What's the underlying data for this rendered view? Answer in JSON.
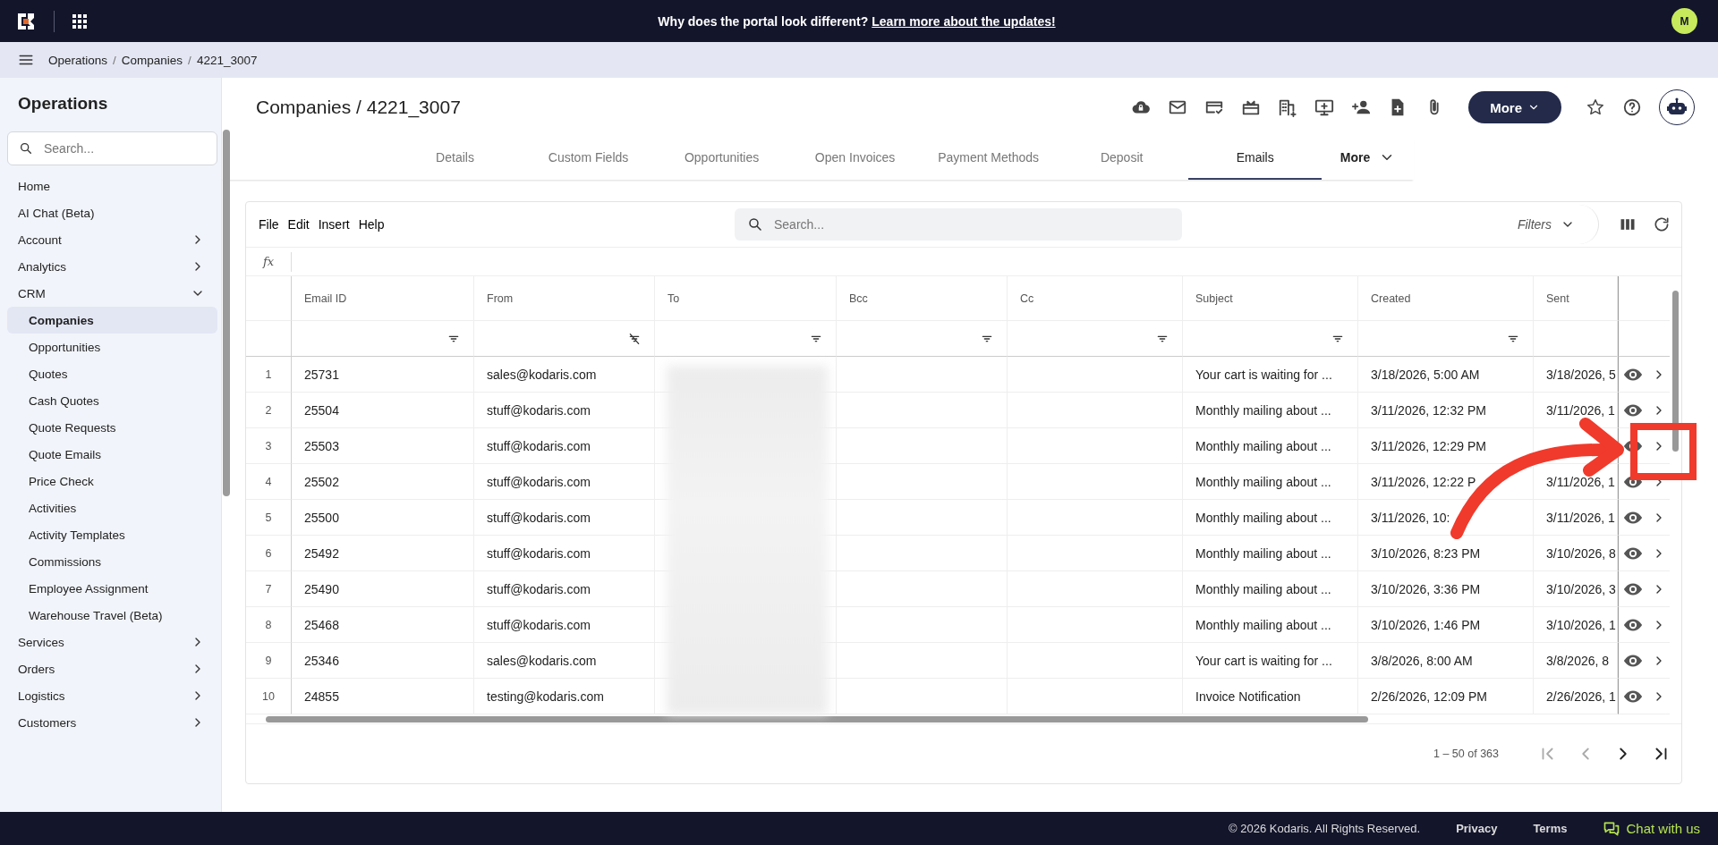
{
  "banner": {
    "text": "Why does the portal look different?",
    "link": "Learn more about the updates!"
  },
  "avatar": "M",
  "breadcrumb": {
    "separator": "/",
    "items": [
      "Operations",
      "Companies",
      "4221_3007"
    ]
  },
  "sidebar": {
    "title": "Operations",
    "search_placeholder": "Search...",
    "items": [
      {
        "label": "Home",
        "kind": "link",
        "selected": false
      },
      {
        "label": "AI Chat (Beta)",
        "kind": "link",
        "selected": false
      },
      {
        "label": "Account",
        "kind": "group",
        "expanded": false,
        "selected": false
      },
      {
        "label": "Analytics",
        "kind": "group",
        "expanded": false,
        "selected": false
      },
      {
        "label": "CRM",
        "kind": "group",
        "expanded": true,
        "selected": false,
        "children": [
          {
            "label": "Companies",
            "selected": true
          },
          {
            "label": "Opportunities",
            "selected": false
          },
          {
            "label": "Quotes",
            "selected": false
          },
          {
            "label": "Cash Quotes",
            "selected": false
          },
          {
            "label": "Quote Requests",
            "selected": false
          },
          {
            "label": "Quote Emails",
            "selected": false
          },
          {
            "label": "Price Check",
            "selected": false
          },
          {
            "label": "Activities",
            "selected": false
          },
          {
            "label": "Activity Templates",
            "selected": false
          },
          {
            "label": "Commissions",
            "selected": false
          },
          {
            "label": "Employee Assignment",
            "selected": false
          },
          {
            "label": "Warehouse Travel (Beta)",
            "selected": false
          }
        ]
      },
      {
        "label": "Services",
        "kind": "group",
        "expanded": false,
        "selected": false
      },
      {
        "label": "Orders",
        "kind": "group",
        "expanded": false,
        "selected": false
      },
      {
        "label": "Logistics",
        "kind": "group",
        "expanded": false,
        "selected": false
      },
      {
        "label": "Customers",
        "kind": "group",
        "expanded": false,
        "selected": false
      }
    ]
  },
  "page": {
    "title": "Companies / 4221_3007",
    "more_button": "More"
  },
  "tabs": [
    {
      "label": "Details",
      "kind": "tab",
      "selected": false
    },
    {
      "label": "Custom Fields",
      "kind": "tab",
      "selected": false
    },
    {
      "label": "Opportunities",
      "kind": "tab",
      "selected": false
    },
    {
      "label": "Open Invoices",
      "kind": "tab",
      "selected": false
    },
    {
      "label": "Payment Methods",
      "kind": "tab",
      "selected": false
    },
    {
      "label": "Deposit",
      "kind": "tab",
      "selected": false
    },
    {
      "label": "Emails",
      "kind": "tab",
      "selected": true
    },
    {
      "label": "More",
      "kind": "menu",
      "selected": false
    }
  ],
  "grid": {
    "menu": [
      "File",
      "Edit",
      "Insert",
      "Help"
    ],
    "search_placeholder": "Search...",
    "filters": "Filters",
    "formula_label": "fx",
    "columns": [
      {
        "label": "Email ID",
        "kind": "filter"
      },
      {
        "label": "From",
        "kind": "filter-clear"
      },
      {
        "label": "To",
        "kind": "filter"
      },
      {
        "label": "Bcc",
        "kind": "filter"
      },
      {
        "label": "Cc",
        "kind": "filter"
      },
      {
        "label": "Subject",
        "kind": "filter"
      },
      {
        "label": "Created",
        "kind": "filter"
      },
      {
        "label": "Sent",
        "kind": "plain"
      }
    ],
    "rows": [
      {
        "index": "1",
        "email_id": "25731",
        "from": "sales@kodaris.com",
        "subject": "Your cart is waiting for ...",
        "created": "3/18/2026, 5:00 AM",
        "sent": "3/18/2026, 5"
      },
      {
        "index": "2",
        "email_id": "25504",
        "from": "stuff@kodaris.com",
        "subject": "Monthly mailing about ...",
        "created": "3/11/2026, 12:32 PM",
        "sent": "3/11/2026, 1"
      },
      {
        "index": "3",
        "email_id": "25503",
        "from": "stuff@kodaris.com",
        "subject": "Monthly mailing about ...",
        "created": "3/11/2026, 12:29 PM"
      },
      {
        "index": "4",
        "email_id": "25502",
        "from": "stuff@kodaris.com",
        "subject": "Monthly mailing about ...",
        "created": "3/11/2026, 12:22 P",
        "sent": "3/11/2026, 1"
      },
      {
        "index": "5",
        "email_id": "25500",
        "from": "stuff@kodaris.com",
        "subject": "Monthly mailing about ...",
        "created": "3/11/2026, 10:",
        "sent": "3/11/2026, 1"
      },
      {
        "index": "6",
        "email_id": "25492",
        "from": "stuff@kodaris.com",
        "subject": "Monthly mailing about ...",
        "created": "3/10/2026, 8:23 PM",
        "sent": "3/10/2026, 8"
      },
      {
        "index": "7",
        "email_id": "25490",
        "from": "stuff@kodaris.com",
        "subject": "Monthly mailing about ...",
        "created": "3/10/2026, 3:36 PM",
        "sent": "3/10/2026, 3"
      },
      {
        "index": "8",
        "email_id": "25468",
        "from": "stuff@kodaris.com",
        "subject": "Monthly mailing about ...",
        "created": "3/10/2026, 1:46 PM",
        "sent": "3/10/2026, 1"
      },
      {
        "index": "9",
        "email_id": "25346",
        "from": "sales@kodaris.com",
        "subject": "Your cart is waiting for ...",
        "created": "3/8/2026, 8:00 AM",
        "sent": "3/8/2026, 8"
      },
      {
        "index": "10",
        "email_id": "24855",
        "from": "testing@kodaris.com",
        "subject": "Invoice Notification",
        "created": "2/26/2026, 12:09 PM",
        "sent": "2/26/2026, 1"
      }
    ],
    "pager": {
      "range": "1 – 50 of 363",
      "buttons": [
        {
          "kind": "first",
          "disabled": true
        },
        {
          "kind": "prev",
          "disabled": true
        },
        {
          "kind": "next",
          "disabled": false
        },
        {
          "kind": "last",
          "disabled": false
        }
      ]
    }
  },
  "annotation": {
    "kind": "arrow-to-box"
  },
  "footer": {
    "copyright": "© 2026 Kodaris. All Rights Reserved.",
    "links": [
      "Privacy",
      "Terms"
    ],
    "chat": "Chat with us"
  }
}
